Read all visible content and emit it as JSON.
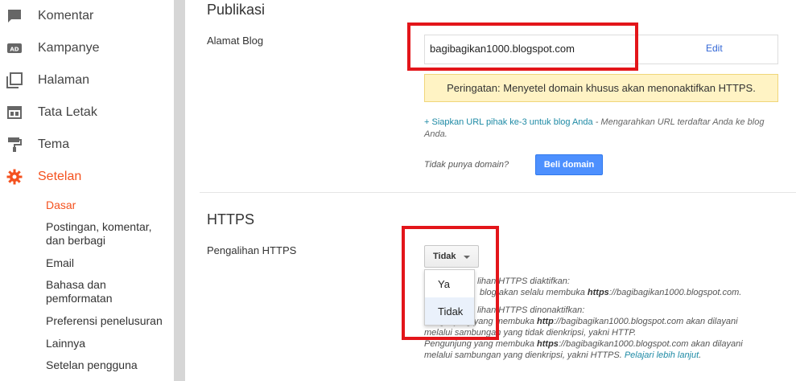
{
  "sidebar": {
    "items": [
      {
        "label": "Komentar",
        "icon": "comment-icon"
      },
      {
        "label": "Kampanye",
        "icon": "ad-icon"
      },
      {
        "label": "Halaman",
        "icon": "pages-icon"
      },
      {
        "label": "Tata Letak",
        "icon": "layout-icon"
      },
      {
        "label": "Tema",
        "icon": "paint-roller-icon"
      },
      {
        "label": "Setelan",
        "icon": "gear-icon"
      }
    ],
    "sub_items": [
      "Dasar",
      "Postingan, komentar, dan berbagi",
      "Email",
      "Bahasa dan pemformatan",
      "Preferensi penelusuran",
      "Lainnya",
      "Setelan pengguna"
    ],
    "accent_color": "#f4511e"
  },
  "publikasi": {
    "title": "Publikasi",
    "address_label": "Alamat Blog",
    "url": "bagibagikan1000.blogspot.com",
    "edit_label": "Edit",
    "warning": "Peringatan: Menyetel domain khusus akan menonaktifkan HTTPS.",
    "third_party_link": "+ Siapkan URL pihak ke-3 untuk blog Anda",
    "third_party_desc": " - Mengarahkan URL terdaftar Anda ke blog Anda.",
    "no_domain": "Tidak punya domain?",
    "buy_domain": "Beli domain"
  },
  "https": {
    "title": "HTTPS",
    "redirect_label": "Pengalihan HTTPS",
    "select_value": "Tidak",
    "options": [
      "Ya",
      "Tidak"
    ],
    "desc1_line1": "lihan HTTPS diaktifkan:",
    "desc1_line2_pre": "blog akan selalu membuka ",
    "desc1_line2_bold": "https",
    "desc1_line2_post": "://bagibagikan1000.blogspot.com.",
    "desc2_line1": "lihan HTTPS dinonaktifkan:",
    "desc2_line2_pre": "Pengunjung yang membuka ",
    "desc2_line2_bold": "http",
    "desc2_line2_post": "://bagibagikan1000.blogspot.com akan dilayani",
    "desc2_line3": "melalui sambungan yang tidak dienkripsi, yakni HTTP.",
    "desc2_line4_pre": "Pengunjung yang membuka ",
    "desc2_line4_bold": "https",
    "desc2_line4_post": "://bagibagikan1000.blogspot.com akan dilayani",
    "desc2_line5": "melalui sambungan yang dienkripsi, yakni HTTPS. ",
    "learn_more": "Pelajari lebih lanjut",
    "learn_more_end": "."
  }
}
